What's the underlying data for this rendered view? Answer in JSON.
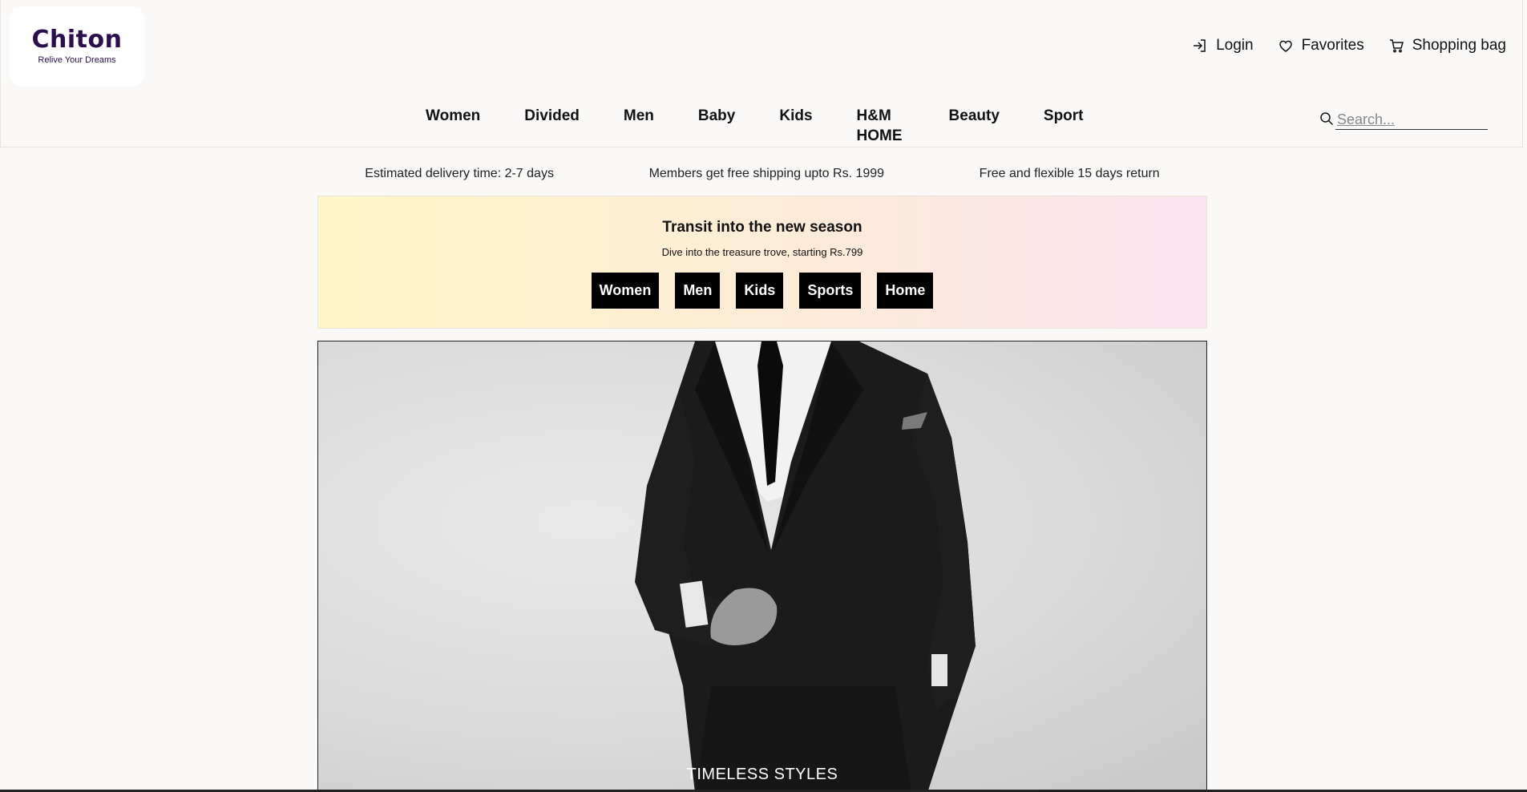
{
  "brand": {
    "name": "Chiton",
    "tagline": "Relive Your Dreams",
    "color": "#2a0e4d"
  },
  "top_actions": {
    "login": "Login",
    "favorites": "Favorites",
    "shopping_bag": "Shopping bag"
  },
  "nav": {
    "items": [
      "Women",
      "Divided",
      "Men",
      "Baby",
      "Kids",
      "H&M HOME",
      "Beauty",
      "Sport"
    ]
  },
  "search": {
    "placeholder": "Search..."
  },
  "info": {
    "delivery": "Estimated delivery time: 2-7 days",
    "shipping": "Members get free shipping upto Rs. 1999",
    "returns": "Free and flexible 15 days return"
  },
  "promo": {
    "title": "Transit into the new season",
    "subtitle": "Dive into the treasure trove, starting Rs.799",
    "buttons": [
      "Women",
      "Men",
      "Kids",
      "Sports",
      "Home"
    ]
  },
  "hero": {
    "caption": "TIMELESS STYLES"
  }
}
